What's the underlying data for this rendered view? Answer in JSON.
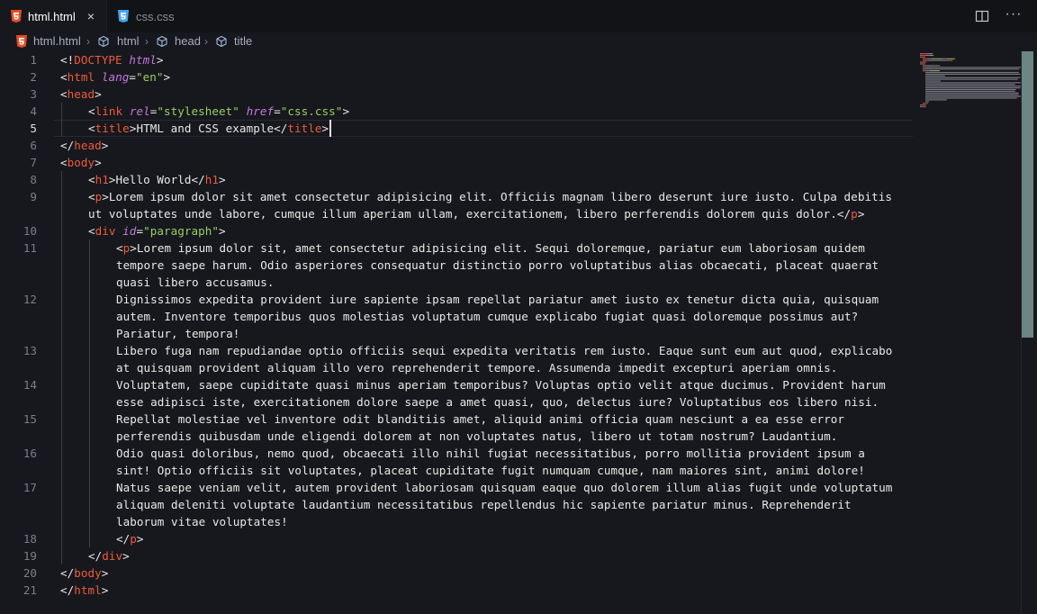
{
  "tabs": [
    {
      "label": "html.html",
      "icon": "html5-icon",
      "active": true,
      "close": "×"
    },
    {
      "label": "css.css",
      "icon": "css3-icon",
      "active": false
    }
  ],
  "editor_actions": {
    "split": "split-editor-icon",
    "more": "···"
  },
  "breadcrumb": [
    {
      "label": "html.html",
      "icon": "html5-icon"
    },
    {
      "label": "html",
      "icon": "element-cube-icon"
    },
    {
      "label": "head",
      "icon": "element-cube-icon"
    },
    {
      "label": "title",
      "icon": "element-cube-icon"
    }
  ],
  "editor": {
    "active_line": 5,
    "lines": [
      {
        "n": "1",
        "rows": [
          [
            [
              "br",
              "<!"
            ],
            [
              "tag",
              "DOCTYPE "
            ],
            [
              "attr",
              "html"
            ],
            [
              "br",
              ">"
            ]
          ]
        ]
      },
      {
        "n": "2",
        "rows": [
          [
            [
              "br",
              "<"
            ],
            [
              "tag",
              "html "
            ],
            [
              "attr",
              "lang"
            ],
            [
              "br",
              "="
            ],
            [
              "str",
              "\"en\""
            ],
            [
              "br",
              ">"
            ]
          ]
        ]
      },
      {
        "n": "3",
        "rows": [
          [
            [
              "br",
              "<"
            ],
            [
              "tag",
              "head"
            ],
            [
              "br",
              ">"
            ]
          ]
        ]
      },
      {
        "n": "4",
        "indent": 1,
        "rows": [
          [
            [
              "br",
              "<"
            ],
            [
              "tag",
              "link "
            ],
            [
              "attr",
              "rel"
            ],
            [
              "br",
              "="
            ],
            [
              "str",
              "\"stylesheet\" "
            ],
            [
              "attr",
              "href"
            ],
            [
              "br",
              "="
            ],
            [
              "str",
              "\"css.css\""
            ],
            [
              "br",
              ">"
            ]
          ]
        ]
      },
      {
        "n": "5",
        "indent": 1,
        "rows": [
          [
            [
              "br",
              "<"
            ],
            [
              "tag",
              "title"
            ],
            [
              "br",
              ">"
            ],
            [
              "txt",
              "HTML and CSS example"
            ],
            [
              "br",
              "</"
            ],
            [
              "tag",
              "title"
            ],
            [
              "br",
              ">"
            ]
          ]
        ]
      },
      {
        "n": "6",
        "rows": [
          [
            [
              "br",
              "</"
            ],
            [
              "tag",
              "head"
            ],
            [
              "br",
              ">"
            ]
          ]
        ]
      },
      {
        "n": "7",
        "rows": [
          [
            [
              "br",
              "<"
            ],
            [
              "tag",
              "body"
            ],
            [
              "br",
              ">"
            ]
          ]
        ]
      },
      {
        "n": "8",
        "indent": 1,
        "rows": [
          [
            [
              "br",
              "<"
            ],
            [
              "tag",
              "h1"
            ],
            [
              "br",
              ">"
            ],
            [
              "txt",
              "Hello World"
            ],
            [
              "br",
              "</"
            ],
            [
              "tag",
              "h1"
            ],
            [
              "br",
              ">"
            ]
          ]
        ]
      },
      {
        "n": "9",
        "indent": 1,
        "rows": [
          [
            [
              "br",
              "<"
            ],
            [
              "tag",
              "p"
            ],
            [
              "br",
              ">"
            ],
            [
              "txt",
              "Lorem ipsum dolor sit amet consectetur adipisicing elit. Officiis magnam libero deserunt iure iusto. Culpa debitis"
            ]
          ],
          [
            [
              "txt",
              "ut voluptates unde labore, cumque illum aperiam ullam, exercitationem, libero perferendis dolorem quis dolor."
            ],
            [
              "br",
              "</"
            ],
            [
              "tag",
              "p"
            ],
            [
              "br",
              ">"
            ]
          ]
        ]
      },
      {
        "n": "10",
        "indent": 1,
        "rows": [
          [
            [
              "br",
              "<"
            ],
            [
              "tag",
              "div "
            ],
            [
              "attr",
              "id"
            ],
            [
              "br",
              "="
            ],
            [
              "str",
              "\"paragraph\""
            ],
            [
              "br",
              ">"
            ]
          ]
        ]
      },
      {
        "n": "11",
        "indent": 2,
        "rows": [
          [
            [
              "br",
              "<"
            ],
            [
              "tag",
              "p"
            ],
            [
              "br",
              ">"
            ],
            [
              "txt",
              "Lorem ipsum dolor sit, amet consectetur adipisicing elit. Sequi doloremque, pariatur eum laboriosam quidem"
            ]
          ],
          [
            [
              "txt",
              "tempore saepe harum. Odio asperiores consequatur distinctio porro voluptatibus alias obcaecati, placeat quaerat"
            ]
          ],
          [
            [
              "txt",
              "quasi libero accusamus."
            ]
          ]
        ]
      },
      {
        "n": "12",
        "indent": 2,
        "rows": [
          [
            [
              "txt",
              "Dignissimos expedita provident iure sapiente ipsam repellat pariatur amet iusto ex tenetur dicta quia, quisquam"
            ]
          ],
          [
            [
              "txt",
              "autem. Inventore temporibus quos molestias voluptatum cumque explicabo fugiat quasi doloremque possimus aut?"
            ]
          ],
          [
            [
              "txt",
              "Pariatur, tempora!"
            ]
          ]
        ]
      },
      {
        "n": "13",
        "indent": 2,
        "rows": [
          [
            [
              "txt",
              "Libero fuga nam repudiandae optio officiis sequi expedita veritatis rem iusto. Eaque sunt eum aut quod, explicabo"
            ]
          ],
          [
            [
              "txt",
              "at quisquam provident aliquam illo vero reprehenderit tempore. Assumenda impedit excepturi aperiam omnis."
            ]
          ]
        ]
      },
      {
        "n": "14",
        "indent": 2,
        "rows": [
          [
            [
              "txt",
              "Voluptatem, saepe cupiditate quasi minus aperiam temporibus? Voluptas optio velit atque ducimus. Provident harum"
            ]
          ],
          [
            [
              "txt",
              "esse adipisci iste, exercitationem dolore saepe a amet quasi, quo, delectus iure? Voluptatibus eos libero nisi."
            ]
          ]
        ]
      },
      {
        "n": "15",
        "indent": 2,
        "rows": [
          [
            [
              "txt",
              "Repellat molestiae vel inventore odit blanditiis amet, aliquid animi officia quam nesciunt a ea esse error"
            ]
          ],
          [
            [
              "txt",
              "perferendis quibusdam unde eligendi dolorem at non voluptates natus, libero ut totam nostrum? Laudantium."
            ]
          ]
        ]
      },
      {
        "n": "16",
        "indent": 2,
        "rows": [
          [
            [
              "txt",
              "Odio quasi doloribus, nemo quod, obcaecati illo nihil fugiat necessitatibus, porro mollitia provident ipsum a"
            ]
          ],
          [
            [
              "txt",
              "sint! Optio officiis sit voluptates, placeat cupiditate fugit numquam cumque, nam maiores sint, animi dolore!"
            ]
          ]
        ]
      },
      {
        "n": "17",
        "indent": 2,
        "rows": [
          [
            [
              "txt",
              "Natus saepe veniam velit, autem provident laboriosam quisquam eaque quo dolorem illum alias fugit unde voluptatum"
            ]
          ],
          [
            [
              "txt",
              "aliquam deleniti voluptate laudantium necessitatibus repellendus hic sapiente pariatur minus. Reprehenderit"
            ]
          ],
          [
            [
              "txt",
              "laborum vitae voluptates!"
            ]
          ]
        ]
      },
      {
        "n": "18",
        "indent": 2,
        "rows": [
          [
            [
              "br",
              "</"
            ],
            [
              "tag",
              "p"
            ],
            [
              "br",
              ">"
            ]
          ]
        ]
      },
      {
        "n": "19",
        "indent": 1,
        "rows": [
          [
            [
              "br",
              "</"
            ],
            [
              "tag",
              "div"
            ],
            [
              "br",
              ">"
            ]
          ]
        ]
      },
      {
        "n": "20",
        "rows": [
          [
            [
              "br",
              "</"
            ],
            [
              "tag",
              "body"
            ],
            [
              "br",
              ">"
            ]
          ]
        ]
      },
      {
        "n": "21",
        "rows": [
          [
            [
              "br",
              "</"
            ],
            [
              "tag",
              "html"
            ],
            [
              "br",
              ">"
            ]
          ]
        ]
      }
    ]
  },
  "colors": {
    "tag": "#f05a3c",
    "attribute": "#c678dd",
    "string": "#9ccc65",
    "text": "#e8e8e8",
    "line_number": "#7a7f87",
    "background": "#16181d",
    "scrollbar_thumb": "#7a9a95"
  }
}
